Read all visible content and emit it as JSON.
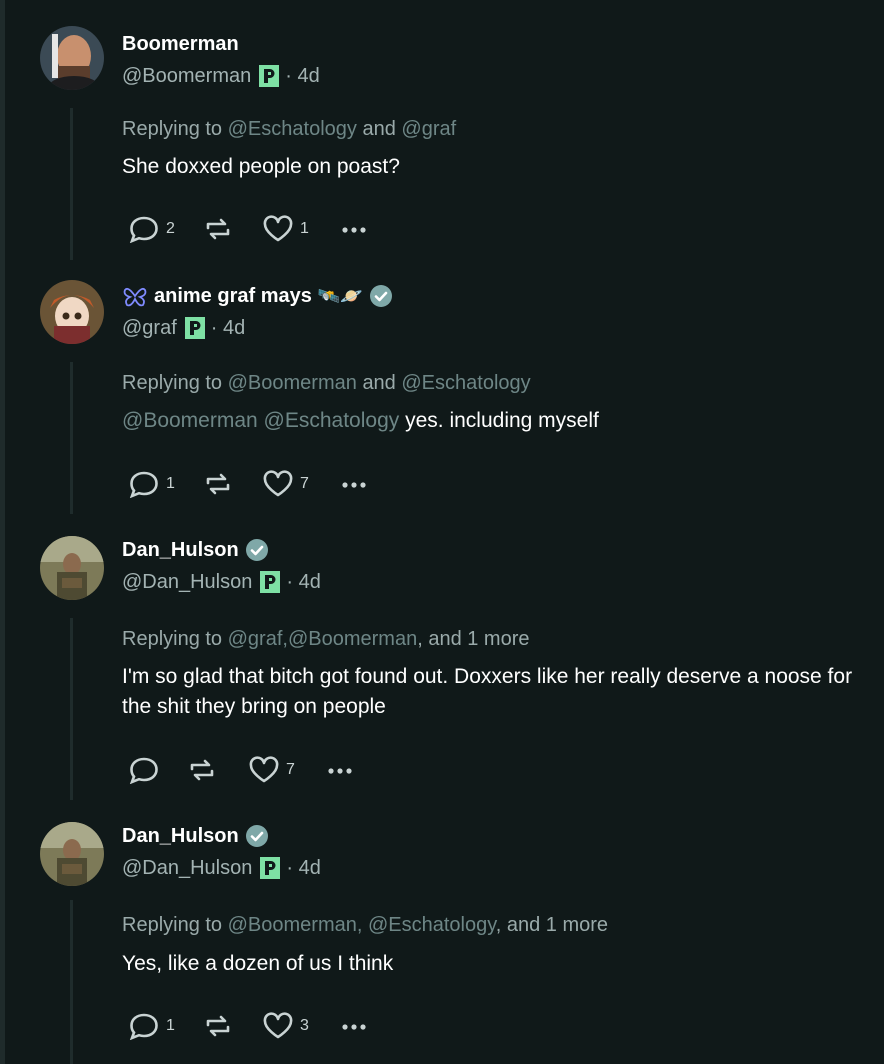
{
  "posts": [
    {
      "name": "Boomerman",
      "handle": "@Boomerman",
      "time": "· 4d",
      "replying_prefix": "Replying to",
      "replying_a": "@Eschatology",
      "replying_sep": "and",
      "replying_b": "@graf",
      "replying_tail": "",
      "body_mentions": "",
      "body": "She doxxed people on poast?",
      "replies": "2",
      "reposts": "",
      "likes": "1"
    },
    {
      "name": "anime graf mays",
      "name_emoji": "🛰️🪐",
      "handle": "@graf",
      "time": "· 4d",
      "replying_prefix": "Replying to",
      "replying_a": "@Boomerman",
      "replying_sep": "and",
      "replying_b": "@Eschatology",
      "replying_tail": "",
      "body_mentions": "@Boomerman @Eschatology",
      "body": "yes. including myself",
      "replies": "1",
      "reposts": "",
      "likes": "7"
    },
    {
      "name": "Dan_Hulson",
      "handle": "@Dan_Hulson",
      "time": "· 4d",
      "replying_prefix": "Replying to",
      "replying_a": "@graf,",
      "replying_sep": "",
      "replying_b": "@Boomerman",
      "replying_tail": ", and 1 more",
      "body_mentions": "",
      "body": "I'm so glad that bitch got found out. Doxxers like her really deserve a noose for the shit they bring on people",
      "replies": "",
      "reposts": "",
      "likes": "7"
    },
    {
      "name": "Dan_Hulson",
      "handle": "@Dan_Hulson",
      "time": "· 4d",
      "replying_prefix": "Replying to",
      "replying_a": "@Boomerman,",
      "replying_sep": "",
      "replying_b": "@Eschatology",
      "replying_tail": ", and 1 more",
      "body_mentions": "",
      "body": "Yes, like a dozen of us I think",
      "replies": "1",
      "reposts": "",
      "likes": "3"
    }
  ],
  "colors": {
    "background": "#101919",
    "mention": "#6e8686",
    "muted": "#a3b3b3",
    "verified": "#7fa8a8",
    "p_badge": "#7ee0a4"
  },
  "icons": {
    "reply": "reply-icon",
    "repost": "repost-icon",
    "like": "heart-icon",
    "more": "more-icon",
    "verified": "verified-icon",
    "badge": "p-badge-icon"
  }
}
